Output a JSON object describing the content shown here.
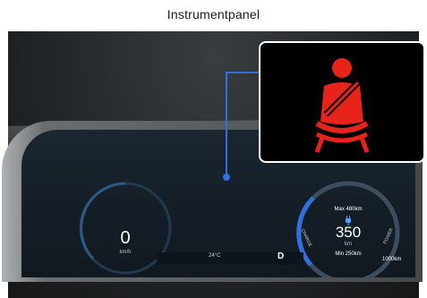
{
  "title": "Instrumentpanel",
  "speedometer": {
    "value": "0",
    "unit": "km/h"
  },
  "ev_gauge": {
    "max_label": "Max 480km",
    "range_value": "350",
    "range_unit": "km",
    "min_label": "Min 250km",
    "left_arc_label": "CHARGE",
    "right_arc_label": "POWER",
    "plug_icon": "charging-plug-icon"
  },
  "status_bar": {
    "temperature": "24°C",
    "gear": "D"
  },
  "odometer": "1000km",
  "callout": {
    "icon": "seat-belt-warning-icon",
    "color": "#e8231a"
  },
  "colors": {
    "accent": "#2f6fe0",
    "warning": "#e8231a",
    "screen": "#141d26"
  }
}
